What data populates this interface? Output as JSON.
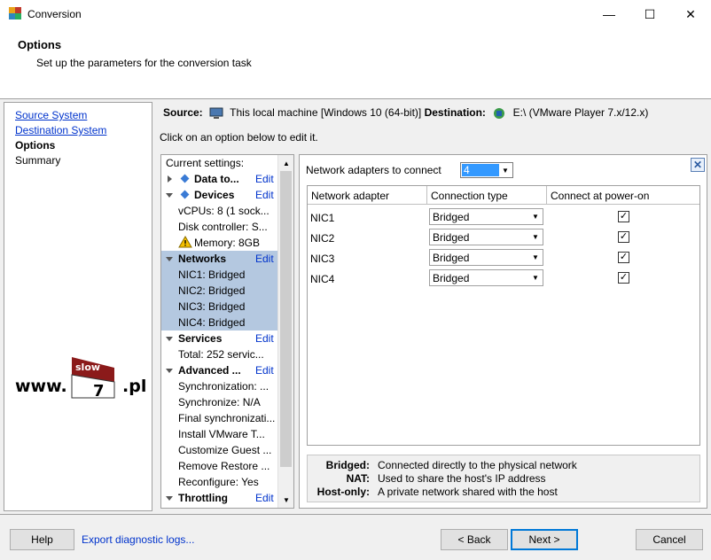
{
  "window": {
    "title": "Conversion",
    "minimize": "—",
    "maximize": "☐",
    "close": "✕"
  },
  "header": {
    "title": "Options",
    "subtitle": "Set up the parameters for the conversion task"
  },
  "nav": {
    "items": [
      "Source System",
      "Destination System",
      "Options",
      "Summary"
    ]
  },
  "logo": {
    "www": "www.",
    "text": "slow",
    "number": "7",
    "pl": ".pl"
  },
  "source": {
    "source_label": "Source:",
    "source_value": "This local machine [Windows 10 (64-bit)]",
    "dest_label": "Destination:",
    "dest_value": "E:\\ (VMware Player 7.x/12.x)"
  },
  "hint": "Click on an option below to edit it.",
  "settings": {
    "header": "Current settings:",
    "edit": "Edit",
    "rows": [
      "Data to...",
      "Devices",
      "vCPUs: 8 (1 sock...",
      "Disk controller: S...",
      "Memory: 8GB",
      "Networks",
      "NIC1: Bridged",
      "NIC2: Bridged",
      "NIC3: Bridged",
      "NIC4: Bridged",
      "Services",
      "Total: 252 servic...",
      "Advanced ...",
      "Synchronization: ...",
      "Synchronize: N/A",
      "Final synchronizati...",
      "Install VMware T...",
      "Customize Guest ...",
      "Remove Restore ...",
      "Reconfigure: Yes",
      "Throttling"
    ]
  },
  "config": {
    "adapters_label": "Network adapters to connect",
    "adapters_value": "4",
    "columns": [
      "Network adapter",
      "Connection type",
      "Connect at power-on"
    ],
    "rows": [
      {
        "name": "NIC1",
        "type": "Bridged",
        "connect": true
      },
      {
        "name": "NIC2",
        "type": "Bridged",
        "connect": true
      },
      {
        "name": "NIC3",
        "type": "Bridged",
        "connect": true
      },
      {
        "name": "NIC4",
        "type": "Bridged",
        "connect": true
      }
    ],
    "legend": [
      {
        "term": "Bridged:",
        "desc": "Connected directly to the physical network"
      },
      {
        "term": "NAT:",
        "desc": "Used to share the host's IP address"
      },
      {
        "term": "Host-only:",
        "desc": "A private network shared with the host"
      }
    ]
  },
  "footer": {
    "help": "Help",
    "export": "Export diagnostic logs...",
    "back": "< Back",
    "next": "Next >",
    "cancel": "Cancel"
  }
}
